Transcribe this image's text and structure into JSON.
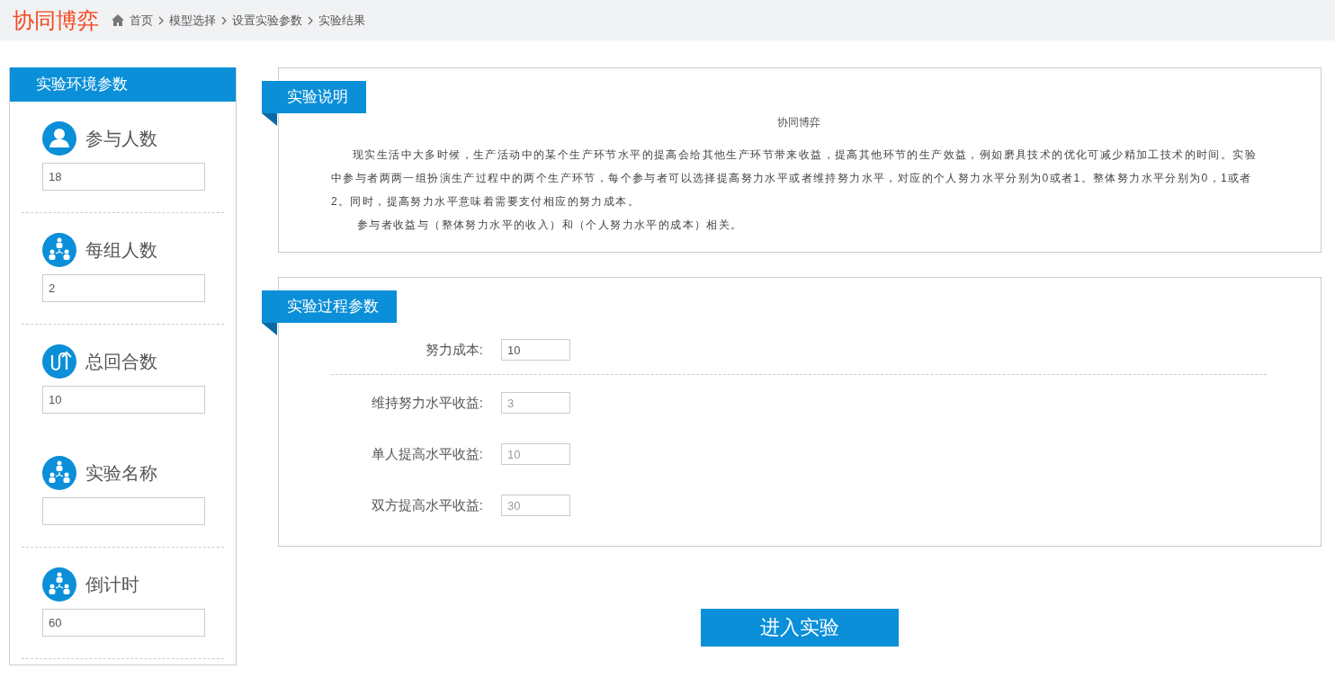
{
  "header": {
    "logo": "协同博弈",
    "breadcrumbs": [
      "首页",
      "模型选择",
      "设置实验参数",
      "实验结果"
    ]
  },
  "env_panel": {
    "title": "实验环境参数",
    "items": [
      {
        "kind": "person",
        "label": "参与人数",
        "value": "18",
        "divider": true
      },
      {
        "kind": "group",
        "label": "每组人数",
        "value": "2",
        "divider": true
      },
      {
        "kind": "loop",
        "label": "总回合数",
        "value": "10",
        "divider": false
      },
      {
        "kind": "group",
        "label": "实验名称",
        "value": "",
        "divider": true
      },
      {
        "kind": "group",
        "label": "倒计时",
        "value": "60",
        "divider": true
      }
    ]
  },
  "description": {
    "title": "实验说明",
    "heading": "协同博弈",
    "paragraphs": [
      "现实生活中大多时候，生产活动中的某个生产环节水平的提高会给其他生产环节带来收益，提高其他环节的生产效益，例如磨具技术的优化可减少精加工技术的时间。实验中参与者两两一组扮演生产过程中的两个生产环节，每个参与者可以选择提高努力水平或者维持努力水平，对应的个人努力水平分别为0或者1。整体努力水平分别为0，1或者2。同时，提高努力水平意味着需要支付相应的努力成本。",
      "参与者收益与（整体努力水平的收入）和（个人努力水平的成本）相关。"
    ]
  },
  "process_panel": {
    "title": "实验过程参数",
    "fields": [
      {
        "label": "努力成本:",
        "value": "10",
        "disabled": false
      },
      {
        "label": "维持努力水平收益:",
        "value": "3",
        "disabled": true
      },
      {
        "label": "单人提高水平收益:",
        "value": "10",
        "disabled": true
      },
      {
        "label": "双方提高水平收益:",
        "value": "30",
        "disabled": true
      }
    ]
  },
  "enter_button": "进入实验"
}
